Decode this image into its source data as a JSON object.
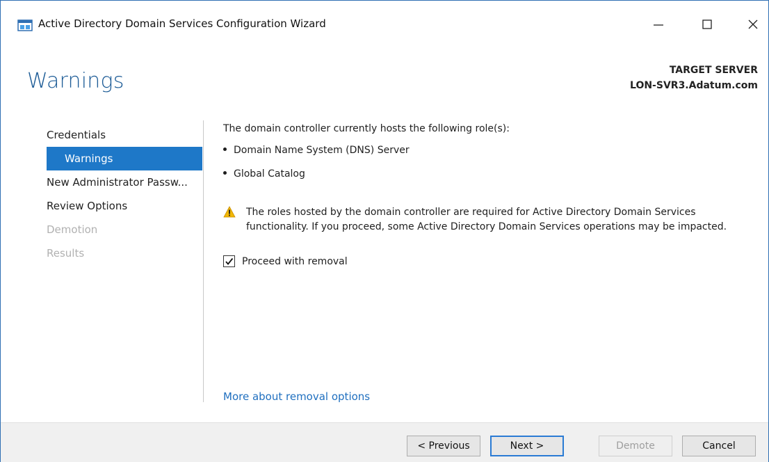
{
  "window": {
    "title": "Active Directory Domain Services Configuration Wizard",
    "controls": {
      "minimize": "—",
      "maximize": "☐",
      "close": "✕"
    }
  },
  "header": {
    "page_title": "Warnings",
    "target_label": "TARGET SERVER",
    "target_value": "LON-SVR3.Adatum.com"
  },
  "nav": {
    "items": [
      {
        "label": "Credentials",
        "state": "normal"
      },
      {
        "label": "Warnings",
        "state": "active"
      },
      {
        "label": "New Administrator Passw...",
        "state": "normal"
      },
      {
        "label": "Review Options",
        "state": "normal"
      },
      {
        "label": "Demotion",
        "state": "disabled"
      },
      {
        "label": "Results",
        "state": "disabled"
      }
    ]
  },
  "content": {
    "intro": "The domain controller currently hosts the following role(s):",
    "roles": [
      "Domain Name System (DNS) Server",
      "Global Catalog"
    ],
    "warning": "The roles hosted by the domain controller are required for Active Directory Domain Services functionality. If you proceed, some Active Directory Domain Services operations may be impacted.",
    "checkbox_label": "Proceed with removal",
    "checkbox_checked": true,
    "more_link": "More about removal options"
  },
  "footer": {
    "previous": "< Previous",
    "next": "Next >",
    "demote": "Demote",
    "cancel": "Cancel"
  },
  "colors": {
    "accent": "#1e78c8",
    "title_blue": "#1c5b96",
    "link": "#1f6fbf",
    "warning": "#f2b705"
  }
}
